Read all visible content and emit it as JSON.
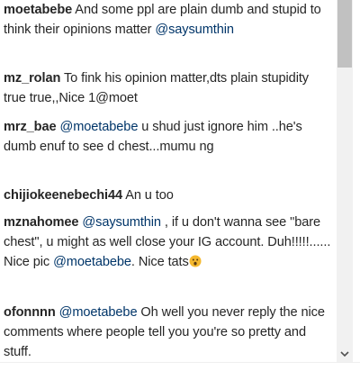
{
  "comments": [
    {
      "user": "moetabebe",
      "parts": [
        {
          "text": " And some ppl are plain dumb and stupid to think their opinions matter ",
          "mention": false
        },
        {
          "text": "@saysumthin",
          "mention": true
        }
      ]
    },
    {
      "user": "mz_rolan",
      "parts": [
        {
          "text": " To fink his opinion matter,dts plain stupidity true true,,Nice 1@moet",
          "mention": false
        }
      ]
    },
    {
      "user": "mrz_bae",
      "parts": [
        {
          "text": " ",
          "mention": false
        },
        {
          "text": "@moetabebe",
          "mention": true
        },
        {
          "text": " u shud just ignore him ..he's dumb enuf to see d chest...mumu ng",
          "mention": false
        }
      ]
    },
    {
      "user": "chijiokeenebechi44",
      "parts": [
        {
          "text": " An u too",
          "mention": false
        }
      ]
    },
    {
      "user": "mznahomee",
      "parts": [
        {
          "text": " ",
          "mention": false
        },
        {
          "text": "@saysumthin",
          "mention": true
        },
        {
          "text": " , if u don't wanna see \"bare chest\", u might as well close your IG account. Duh!!!!!...... Nice pic ",
          "mention": false
        },
        {
          "text": "@moetabebe",
          "mention": true
        },
        {
          "text": ". Nice tats",
          "mention": false
        }
      ],
      "emoji": "surprised-face-emoji"
    },
    {
      "user": "ofonnnn",
      "parts": [
        {
          "text": " ",
          "mention": false
        },
        {
          "text": "@moetabebe",
          "mention": true
        },
        {
          "text": " Oh well you never reply the nice comments where people tell you you're so pretty and stuff.",
          "mention": false
        }
      ]
    }
  ],
  "colors": {
    "text": "#262626",
    "mention": "#003569",
    "emoji": "#f5b82e"
  }
}
